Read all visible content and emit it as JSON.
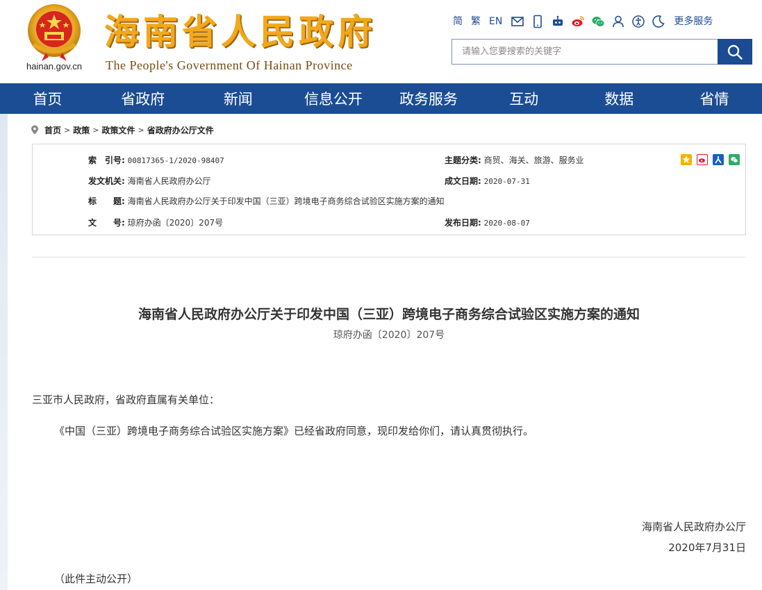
{
  "header": {
    "domain": "hainan.gov.cn",
    "title": "海南省人民政府",
    "subtitle": "The People's Government Of Hainan Province",
    "tools": {
      "simplified": "简",
      "traditional": "繁",
      "english": "EN",
      "more_services": "更多服务",
      "icons": [
        "mail-icon",
        "mobile-icon",
        "robot-icon",
        "weibo-icon",
        "wechat-icon",
        "user-icon",
        "accessibility-icon",
        "care-mode-icon"
      ]
    },
    "search": {
      "placeholder": "请输入您要搜索的关键字"
    }
  },
  "nav": {
    "items": [
      "首页",
      "省政府",
      "新闻",
      "信息公开",
      "政务服务",
      "互动",
      "数据",
      "省情"
    ]
  },
  "breadcrumb": {
    "items": [
      "首页",
      "政策",
      "政策文件",
      "省政府办公厅文件"
    ],
    "separator": ">"
  },
  "meta": {
    "index_label": "索　引号:",
    "index_value": "00817365-1/2020-98407",
    "topic_label": "主题分类:",
    "topic_value": "商贸、海关、旅游、服务业",
    "issuer_label": "发文机关:",
    "issuer_value": "海南省人民政府办公厅",
    "created_label": "成文日期:",
    "created_value": "2020-07-31",
    "title_label": "标　　题:",
    "title_value": "海南省人民政府办公厅关于印发中国（三亚）跨境电子商务综合试验区实施方案的通知",
    "docno_label": "文　　号:",
    "docno_value": "琼府办函〔2020〕207号",
    "published_label": "发布日期:",
    "published_value": "2020-08-07",
    "share_icons": [
      "qzone-share-icon",
      "weibo-share-icon",
      "renren-share-icon",
      "wechat-share-icon"
    ]
  },
  "article": {
    "title": "海南省人民政府办公厅关于印发中国（三亚）跨境电子商务综合试验区实施方案的通知",
    "doc_number": "琼府办函〔2020〕207号",
    "recipient": "三亚市人民政府，省政府直属有关单位：",
    "body": "《中国（三亚）跨境电子商务综合试验区实施方案》已经省政府同意，现印发给你们，请认真贯彻执行。",
    "issuer": "海南省人民政府办公厅",
    "date": "2020年7月31日",
    "note": "（此件主动公开）"
  },
  "colors": {
    "nav_blue": "#1b4d94",
    "title_gold": "#f2a81d",
    "emblem_red": "#d7261e"
  }
}
